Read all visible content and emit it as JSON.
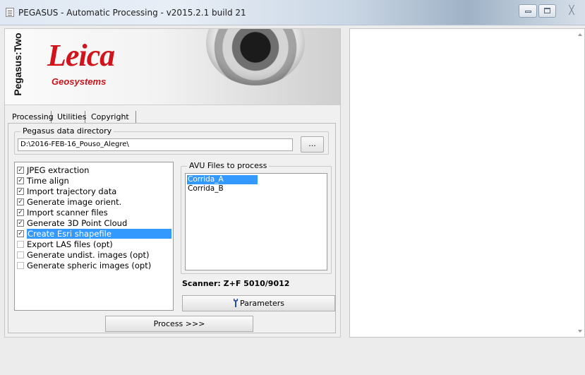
{
  "window": {
    "title": "PEGASUS - Automatic Processing - v2015.2.1 build 21",
    "controls": {
      "minimize": "minimize",
      "maximize": "maximize",
      "close": "╳"
    }
  },
  "banner": {
    "product": "Pegasus:Two",
    "brand": "Leica",
    "brand_sub": "Geosystems",
    "brand_color": "#d0141b"
  },
  "tabs": [
    {
      "label": "Processing",
      "active": true
    },
    {
      "label": "Utilities",
      "active": false
    },
    {
      "label": "Copyright",
      "active": false
    }
  ],
  "data_dir": {
    "legend": "Pegasus data directory",
    "value": "D:\\2016-FEB-16_Pouso_Alegre\\",
    "browse_label": "..."
  },
  "steps": [
    {
      "label": "JPEG extraction",
      "checked": true,
      "selected": false
    },
    {
      "label": "Time align",
      "checked": true,
      "selected": false
    },
    {
      "label": "Import trajectory data",
      "checked": true,
      "selected": false
    },
    {
      "label": "Generate image orient.",
      "checked": true,
      "selected": false
    },
    {
      "label": "Import scanner files",
      "checked": true,
      "selected": false
    },
    {
      "label": "Generate 3D Point Cloud",
      "checked": true,
      "selected": false
    },
    {
      "label": "Create Esri shapefile",
      "checked": true,
      "selected": true
    },
    {
      "label": "Export LAS files (opt)",
      "checked": false,
      "selected": false
    },
    {
      "label": "Generate undist. images (opt)",
      "checked": false,
      "selected": false
    },
    {
      "label": "Generate spheric images (opt)",
      "checked": false,
      "selected": false
    }
  ],
  "avu": {
    "legend": "AVU Files to process",
    "items": [
      {
        "label": "Corrida_A",
        "selected": true
      },
      {
        "label": "Corrida_B",
        "selected": false
      }
    ]
  },
  "scanner_label": "Scanner: Z+F 5010/9012",
  "parameters_label": "Parameters",
  "process_label": "Process >>>",
  "colors": {
    "selection": "#3399ff",
    "wrench": "#1f4fa8"
  },
  "icons": {
    "app": "app-icon",
    "wrench": "wrench-icon"
  }
}
